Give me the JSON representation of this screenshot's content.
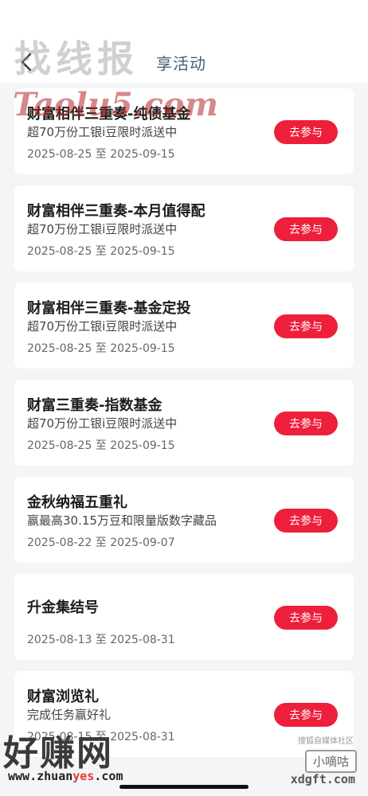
{
  "header": {
    "title": "享活动"
  },
  "activities": [
    {
      "title": "财富相伴三重奏-纯债基金",
      "desc": "超70万份工银i豆限时派送中",
      "date": "2025-08-25 至 2025-09-15",
      "button": "去参与"
    },
    {
      "title": "财富相伴三重奏-本月值得配",
      "desc": "超70万份工银i豆限时派送中",
      "date": "2025-08-25 至 2025-09-15",
      "button": "去参与"
    },
    {
      "title": "财富相伴三重奏-基金定投",
      "desc": "超70万份工银i豆限时派送中",
      "date": "2025-08-25 至 2025-09-15",
      "button": "去参与"
    },
    {
      "title": "财富三重奏-指数基金",
      "desc": "超70万份工银i豆限时派送中",
      "date": "2025-08-25 至 2025-09-15",
      "button": "去参与"
    },
    {
      "title": "金秋纳福五重礼",
      "desc": "赢最高30.15万豆和限量版数字藏品",
      "date": "2025-08-22 至 2025-09-07",
      "button": "去参与"
    },
    {
      "title": "升金集结号",
      "desc": "",
      "date": "2025-08-13 至 2025-08-31",
      "button": "去参与"
    },
    {
      "title": "财富浏览礼",
      "desc": "完成任务赢好礼",
      "date": "2025-08-15 至 2025-08-31",
      "button": "去参与"
    }
  ],
  "watermarks": {
    "top": "找线报",
    "script": "Taolu5.com",
    "bottom_brand": "好赚网",
    "bottom_url_pre": "www.zhuan",
    "bottom_url_hl": "yes",
    "bottom_url_post": ".com",
    "right_small": "搜狐自媒体社区",
    "right_badge": "小嘀咕",
    "right_url": "xdgft.com"
  },
  "colors": {
    "accent": "#ee1f3a",
    "title_blue": "#4a5c74",
    "background": "#f4f5f7"
  },
  "icons": {
    "back": "chevron-left-icon"
  }
}
